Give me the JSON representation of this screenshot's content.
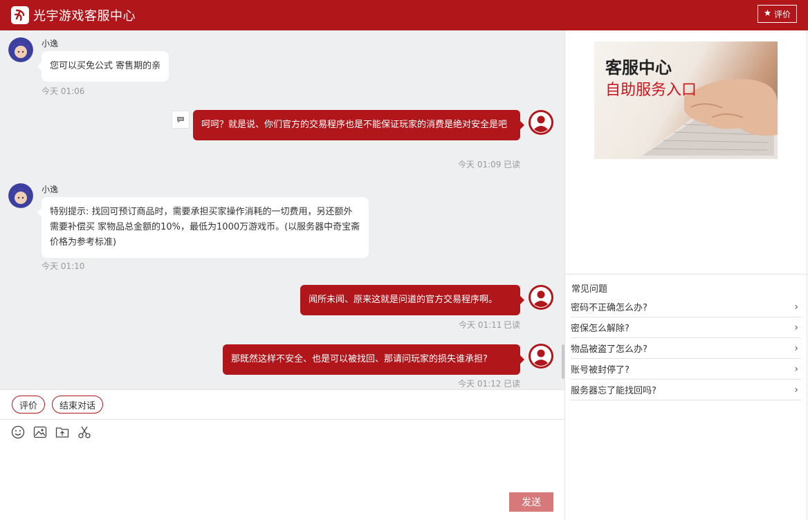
{
  "header": {
    "title": "光宇游戏客服中心",
    "rate_label": "评价"
  },
  "messages": [
    {
      "type": "agent",
      "sender": "小逸",
      "text": "您可以买免公式 寄售期的亲",
      "time": "今天 01:06"
    },
    {
      "type": "user",
      "text": "呵呵？就是说、你们官方的交易程序也是不能保证玩家的消费是绝对安全是吧",
      "time": "今天 01:09",
      "status": "已读"
    },
    {
      "type": "agent",
      "sender": "小逸",
      "text": "特别提示: 找回可预订商品时，需要承担买家操作消耗的一切费用，另还额外需要补偿买 家物品总金额的10%，最低为1000万游戏币。(以服务器中奇宝斋价格为参考标准)",
      "time": "今天 01:10"
    },
    {
      "type": "user",
      "text": "闻所未闻、原来这就是问道的官方交易程序啊。",
      "time": "今天 01:11",
      "status": "已读"
    },
    {
      "type": "user",
      "text": "那既然这样不安全、也是可以被找回、那请问玩家的损失谁承担?",
      "time": "今天 01:12",
      "status": "已读"
    }
  ],
  "actions": {
    "rate": "评价",
    "end": "结束对话"
  },
  "composer": {
    "send": "发送"
  },
  "banner": {
    "title": "客服中心",
    "subtitle": "自助服务入口"
  },
  "faq": {
    "title": "常见问题",
    "items": [
      "密码不正确怎么办?",
      "密保怎么解除?",
      "物品被盗了怎么办?",
      "账号被封停了?",
      "服务器忘了能找回吗?"
    ]
  },
  "colors": {
    "brand": "#b1161b",
    "send_disabled": "#d7787b"
  },
  "icons": [
    "logo-icon",
    "star-icon",
    "user-avatar-icon",
    "agent-avatar-icon",
    "quote-icon",
    "emoji-icon",
    "image-icon",
    "folder-upload-icon",
    "scissors-icon",
    "chevron-right-icon"
  ]
}
